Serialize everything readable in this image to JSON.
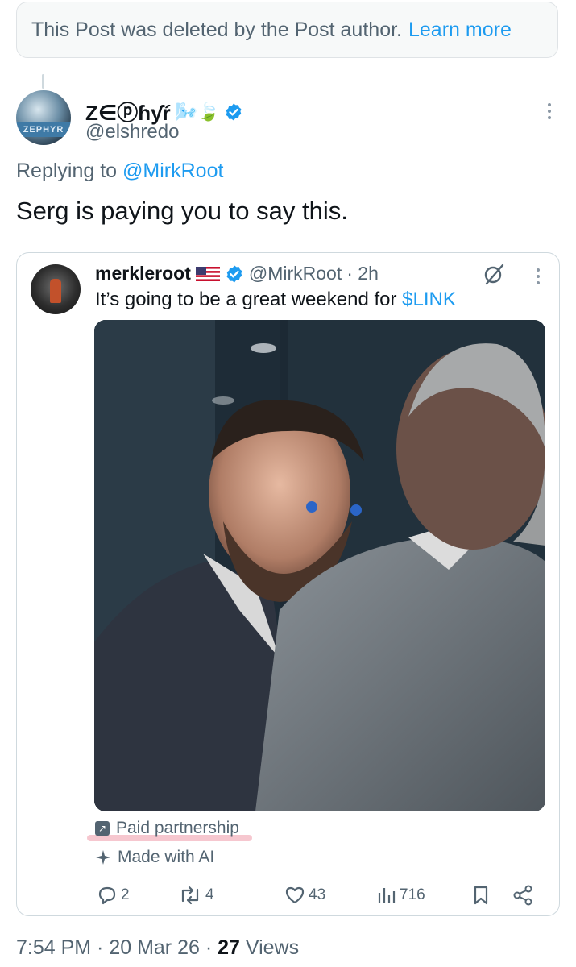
{
  "deleted_notice": {
    "text": "This Post was deleted by the Post author.",
    "link": "Learn more"
  },
  "reply": {
    "author_name": "Z∈ⓟɦƴŕ",
    "author_decorations": "🌬️🍃",
    "handle": "@elshredo",
    "avatar_label": "ZEPHYR",
    "replying_prefix": "Replying to",
    "replying_to": "@MirkRoot",
    "text": "Serg is paying you to say this."
  },
  "quote": {
    "author_name": "merkleroot",
    "handle": "@MirkRoot",
    "time": "· 2h",
    "text_before": "It’s going to be a great weekend for",
    "cashtag": "$LINK",
    "paid_partnership": "Paid partnership",
    "made_with_ai": "Made with AI",
    "stats": {
      "replies": "2",
      "reposts": "4",
      "likes": "43",
      "views": "716"
    }
  },
  "footer": {
    "time": "7:54 PM · 20 Mar 26 ·",
    "views_count": "27",
    "views_label": "Views"
  },
  "colors": {
    "accent": "#1d9bf0",
    "muted": "#536471",
    "highlight": "#f3b4bf"
  }
}
